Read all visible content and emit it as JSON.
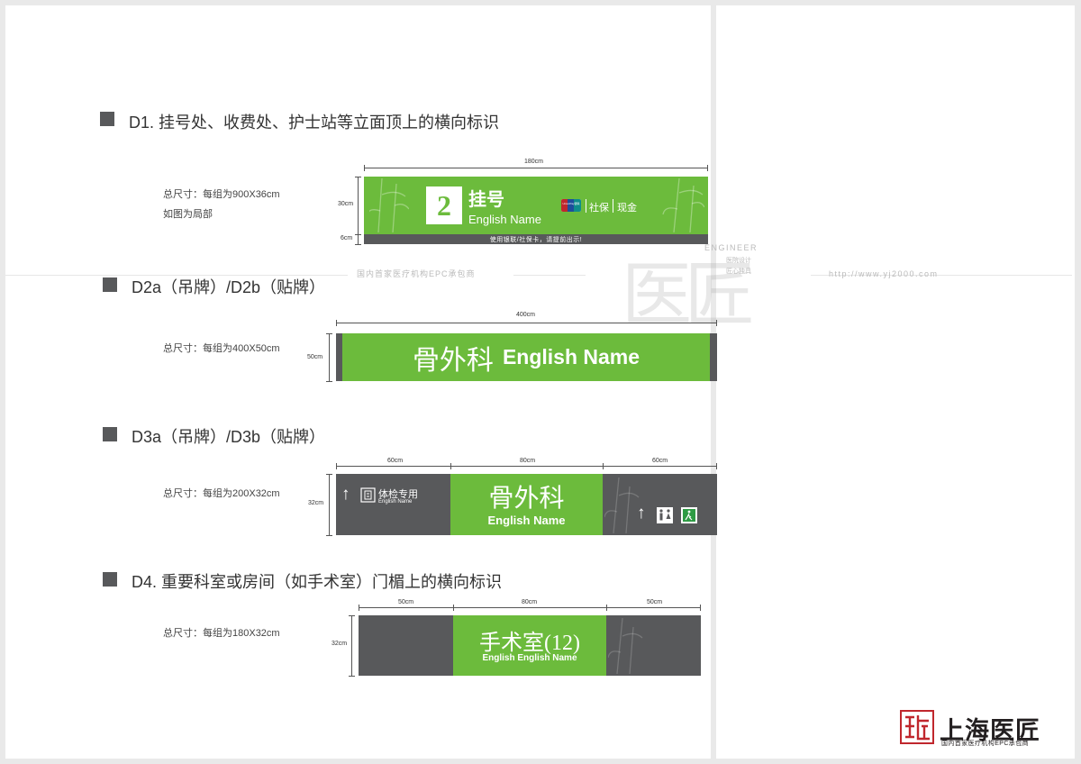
{
  "watermark": {
    "tagline": "国内首家医疗机构EPC承包商",
    "url": "http://www.yj2000.com",
    "engineer": "ENGINEER",
    "design_line1": "医院设计",
    "design_line2": "匠心独具",
    "big_text": "医匠"
  },
  "d1": {
    "title": "D1. 挂号处、收费处、护士站等立面顶上的横向标识",
    "spec_line1": "总尺寸：每组为900X36cm",
    "spec_line2": "如图为局部",
    "dim_width": "180cm",
    "dim_main_height": "30cm",
    "dim_strip_height": "6cm",
    "number": "2",
    "name_cn": "挂号",
    "name_en": "English Name",
    "unionpay": "UnionPay银联",
    "pay_social": "社保",
    "pay_cash": "现金",
    "bottom_note": "使用银联/社保卡，请提前出示!"
  },
  "d2": {
    "title": "D2a（吊牌）/D2b（贴牌）",
    "spec": "总尺寸：每组为400X50cm",
    "dim_width": "400cm",
    "dim_height": "50cm",
    "name_cn": "骨外科",
    "name_en": "English Name"
  },
  "d3": {
    "title": "D3a（吊牌）/D3b（贴牌）",
    "spec": "总尺寸：每组为200X32cm",
    "dim_left": "60cm",
    "dim_mid": "80cm",
    "dim_right": "60cm",
    "dim_height": "32cm",
    "left_cn": "体检专用",
    "left_en": "English Name",
    "name_cn": "骨外科",
    "name_en": "English Name"
  },
  "d4": {
    "title": "D4. 重要科室或房间（如手术室）门楣上的横向标识",
    "spec": "总尺寸：每组为180X32cm",
    "dim_left": "50cm",
    "dim_mid": "80cm",
    "dim_right": "50cm",
    "dim_height": "32cm",
    "name_cn": "手术室(12)",
    "name_en": "English English Name"
  },
  "brand": {
    "name": "上海医匠",
    "tagline": "国内首家医疗机构EPC承包商",
    "colors": {
      "green": "#6cbb3c",
      "gray": "#58595b",
      "seal_red": "#c0272d"
    }
  }
}
